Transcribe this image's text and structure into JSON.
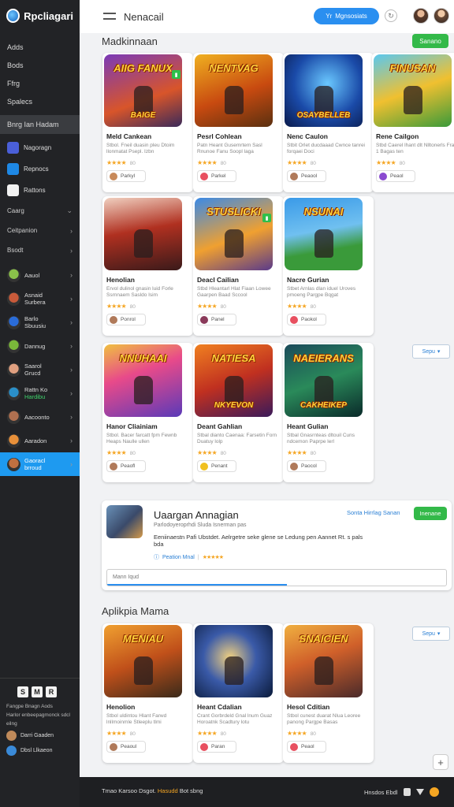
{
  "brand": {
    "name": "Rpcliagari"
  },
  "sidebar": {
    "nav": [
      "Adds",
      "Bods",
      "Ffrg",
      "Spalecs"
    ],
    "highlight": "Bnrg  Ian  Hadam",
    "apps": [
      {
        "label": "Nagoragn",
        "color": "#4a5fd8"
      },
      {
        "label": "Repnocs",
        "color": "#1e88e5"
      },
      {
        "label": "Rattons",
        "color": "#f2f2f2"
      }
    ],
    "groups": [
      {
        "label": "Caarg",
        "chevron": "⌄"
      },
      {
        "label": "Ceitpanion",
        "chevron": "›"
      },
      {
        "label": "Bsodt",
        "chevron": "›"
      }
    ],
    "friends": [
      {
        "name": "Aauol",
        "status": "",
        "color": "#8ac14a"
      },
      {
        "name": "Asnaid",
        "status": "Surbera",
        "color": "#c85a3a"
      },
      {
        "name": "Barlo",
        "status": "Sbuusiu",
        "color": "#2a6cd8"
      },
      {
        "name": "Dannug",
        "status": "",
        "color": "#7ab83a"
      },
      {
        "name": "Saarol",
        "status": "Grucd",
        "color": "#e0a080"
      },
      {
        "name": "Rattn Ko",
        "status": "Hardibu",
        "color": "#2a8fc8"
      },
      {
        "name": "Aacoonto",
        "status": "",
        "color": "#b07050"
      },
      {
        "name": "Aaradon",
        "status": "",
        "color": "#e8903a"
      },
      {
        "name": "Gaoracl",
        "status": "brroud",
        "color": "#c07040"
      }
    ],
    "bottom_buttons": [
      "S",
      "M",
      "R"
    ],
    "bottom_text": [
      "Fangpe  Bnagn  Aods",
      "Harlor  enbeepagmonck  sdcl  eilng"
    ],
    "bottom_users": [
      {
        "name": "Darri Gaaden",
        "color": "#c08a5a"
      },
      {
        "name": "Dbsl  Llkaeon",
        "color": "#3a8ad8"
      }
    ]
  },
  "header": {
    "title": "Nenacail",
    "button_label": "Mgnsosiats",
    "button_icon": "Yr"
  },
  "sections": {
    "top_title": "Madkinnaan",
    "top_button": "Sanano",
    "bottom_title": "Aplikpia Mama",
    "sort_label": "Sepu"
  },
  "cards": [
    {
      "art": "AIIG FANUX",
      "art2": "BAIGE",
      "title": "Meld Cankean",
      "desc": "Stbol. Fneil duasin pleu Dtoim llonmatat Psepl. Izbn",
      "rating": 4,
      "score": "80",
      "action": "Parkyl",
      "dot": "#c88a5a",
      "bg": "linear-gradient(160deg,#7a3ab8,#d8552a 60%,#3a2a5a)",
      "badge": true
    },
    {
      "art": "NENTVAG",
      "art2": "",
      "title": "Pesrl Cohlean",
      "desc": "Patn Heant Gusemrtem Sasl Rnunoe Fanu  Soopl laga",
      "rating": 4,
      "score": "80",
      "action": "Parkel",
      "dot": "#e85060",
      "bg": "linear-gradient(160deg,#f0b020,#c84a10 55%,#5a3010)",
      "badge": false
    },
    {
      "art": "",
      "art2": "OSAYBELLEB",
      "title": "Nenc Caulon",
      "desc": "Stbit  Orlet  ducdaaad Cwnce tanrei forqaei Doci",
      "rating": 4,
      "score": "80",
      "action": "Peaool",
      "dot": "#b07a5a",
      "bg": "radial-gradient(circle at 55% 40%,#6ac8ff,#1a4aa8 55%,#0a1a4a)",
      "badge": false
    },
    {
      "art": "FINUSAN",
      "art2": "",
      "title": "Rene Cailgon",
      "desc": "Stbd Caerel lhant dlt Nlltonerls Fra. 1 Bagas ten",
      "rating": 4,
      "score": "80",
      "action": "Peaol",
      "dot": "#8a4ad0",
      "bg": "linear-gradient(160deg,#5ac8f0,#f0c030 50%,#3a9a3a)",
      "badge": false
    },
    {
      "art": "",
      "art2": "",
      "title": "Henolian",
      "desc": "Ervol dulinol gnasin luid Forle Ssrnnaem Sasldo  Isim",
      "rating": 4,
      "score": "80",
      "action": "Ponrol",
      "dot": "#b07a5a",
      "bg": "linear-gradient(170deg,#f0d0c0,#b03020 45%,#3a1a1a)",
      "badge": false
    },
    {
      "art": "STUSLICKI",
      "art2": "",
      "title": "Deacl Cailian",
      "desc": "Stbd Hleantarl Hlat Fiaan Lowee Gaarpen Baad Sccool",
      "rating": 4,
      "score": "80",
      "action": "Panel",
      "dot": "#8a3a5a",
      "bg": "linear-gradient(160deg,#3a8ae8,#f0a030 55%,#5a3a8a)",
      "badge": true
    },
    {
      "art": "NSUNAI",
      "art2": "",
      "title": "Nacre Gurian",
      "desc": "Stbet Arnlas dlan iduel Uroves pmoeng Pargpe Bqgat",
      "rating": 4,
      "score": "80",
      "action": "Paokol",
      "dot": "#e85060",
      "bg": "linear-gradient(170deg,#3a9ae8,#70c0f0 45%,#3a9a3a 70%)",
      "badge": false
    },
    {
      "art": "NNUHAAI",
      "art2": "",
      "title": "Hanor Cliainiam",
      "desc": "Stbol. Bacer farcatt fpm Fewnb Heaps Naulle ullen",
      "rating": 4,
      "score": "80",
      "action": "Peaofl",
      "dot": "#b07a5a",
      "bg": "linear-gradient(160deg,#f0c040,#e84a8a 40%,#5a3ab8)",
      "badge": false
    },
    {
      "art": "NATIESA",
      "art2": "NKYEVON",
      "title": "Deant Gahlian",
      "desc": "Stbal  dianto  Caenaa: Farsetin Forn  Duatuy lolp",
      "rating": 4,
      "score": "80",
      "action": "Penant",
      "dot": "#f0c020",
      "bg": "linear-gradient(160deg,#f08020,#c03020 50%,#3a1a5a)",
      "badge": false
    },
    {
      "art": "NAEIERANS",
      "art2": "CAKHEIKEP",
      "title": "Heant Gulian",
      "desc": "Stbal Gnasrnteas dltouil Cuns ndcemon Paprpe lerl",
      "rating": 4,
      "score": "80",
      "action": "Paocol",
      "dot": "#b07a5a",
      "bg": "linear-gradient(160deg,#1a4a5a,#2a8a5a 50%,#0a2a2a)",
      "badge": false
    },
    {
      "art": "MENIAU",
      "art2": "",
      "title": "Henolion",
      "desc": "Stbol uldintou Hlant Farwd lnllmoinmle Stleeplu tlmi",
      "rating": 4,
      "score": "80",
      "action": "Peaoul",
      "dot": "#b07a5a",
      "bg": "linear-gradient(160deg,#f0a030,#c0501a 50%,#3a2a1a)",
      "badge": false
    },
    {
      "art": "",
      "art2": "",
      "title": "Heant Cdalian",
      "desc": "Crant Gorbrdeld Gnal lnum Guaz Horoatnk Scadtury lotu",
      "rating": 4,
      "score": "80",
      "action": "Paran",
      "dot": "#e85060",
      "bg": "radial-gradient(circle at 45% 45%,#f0d080,#3a5aa8 45%,#0a1a3a)",
      "badge": false
    },
    {
      "art": "SNAICIEN",
      "art2": "",
      "title": "Hesol Cditian",
      "desc": "Stbol cunest duarat Nlua Leoree panong Pargpe Basas",
      "rating": 4,
      "score": "80",
      "action": "Peaol",
      "dot": "#e85060",
      "bg": "linear-gradient(160deg,#f0b040,#d0602a 45%,#4a2a2a)",
      "badge": false
    }
  ],
  "banner": {
    "title": "Uaargan Annagian",
    "subtitle": "Parlodoyeroprhdi Sluda Isnerman pas",
    "desc": "Eeniinaestn Pafi Ubstdet. Aelrgetre seke glene se  Ledung  pen Aannet Rt. s pals bda",
    "meta_label": "Peation Mnal",
    "rating": 5,
    "link": "Sonta Hirrlag Sanan",
    "button": "Inenane",
    "input_placeholder": "Mann Iqud",
    "progress": 0.53
  },
  "footer": {
    "left_text": "Tmao  Karsoo  Dsgot.",
    "left_highlight": "Hasudd",
    "left_tail": "Bot  sbng",
    "right_text": "Hnsdos  Ebdl"
  },
  "colors": {
    "accent": "#2a8ff0",
    "green": "#33b949",
    "sidebar": "#222326",
    "star": "#f5a623"
  }
}
